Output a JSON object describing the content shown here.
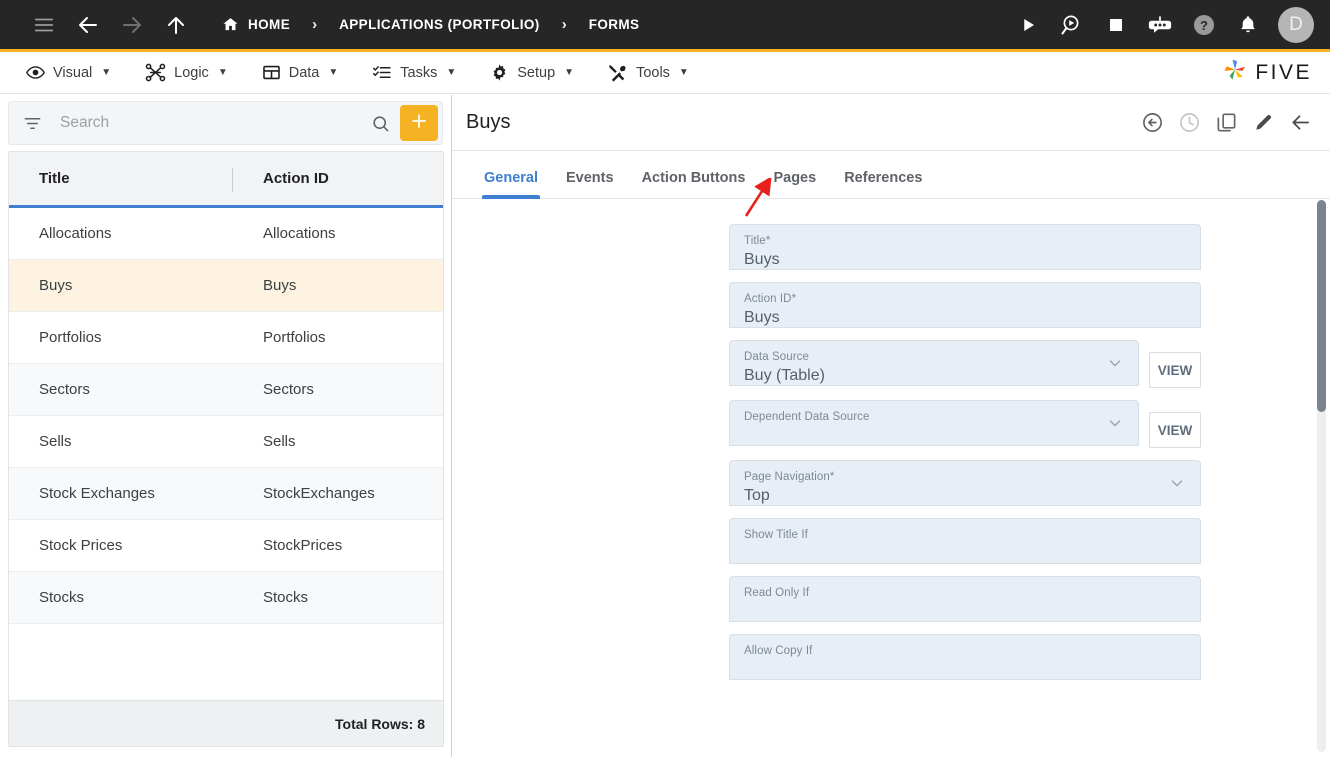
{
  "topbar": {
    "nav_icons": [
      {
        "name": "menu-icon",
        "label": "Menu"
      },
      {
        "name": "back-arrow-icon",
        "label": "Back"
      },
      {
        "name": "forward-arrow-icon",
        "label": "Forward"
      },
      {
        "name": "up-arrow-icon",
        "label": "Up"
      }
    ],
    "breadcrumbs": [
      {
        "label": "HOME",
        "icon": "home-icon"
      },
      {
        "label": "APPLICATIONS (PORTFOLIO)",
        "icon": ""
      },
      {
        "label": "FORMS",
        "icon": ""
      }
    ],
    "separator": "›",
    "right_icons": [
      {
        "name": "play-icon",
        "label": "Run"
      },
      {
        "name": "debug-magnifier-icon",
        "label": "Debug"
      },
      {
        "name": "stop-icon",
        "label": "Stop"
      },
      {
        "name": "bot-icon",
        "label": "Assistant"
      },
      {
        "name": "help-icon",
        "label": "Help"
      },
      {
        "name": "bell-icon",
        "label": "Notifications"
      }
    ],
    "avatar_initial": "D",
    "accent_color": "#f5b324",
    "background_color": "#262626"
  },
  "menubar": {
    "items": [
      {
        "label": "Visual",
        "icon": "eye-icon",
        "caret": "▼"
      },
      {
        "label": "Logic",
        "icon": "logic-nodes-icon",
        "caret": "▼"
      },
      {
        "label": "Data",
        "icon": "table-icon",
        "caret": "▼"
      },
      {
        "label": "Tasks",
        "icon": "checklist-icon",
        "caret": "▼"
      },
      {
        "label": "Setup",
        "icon": "gear-icon",
        "caret": "▼"
      },
      {
        "label": "Tools",
        "icon": "tools-icon",
        "caret": "▼"
      }
    ],
    "logo_text": "FIVE",
    "logo_icon": "five-pinwheel-logo"
  },
  "sidebar": {
    "search": {
      "placeholder": "Search",
      "value": "",
      "filter_icon": "filter-icon",
      "search_icon": "search-icon",
      "add_icon": "plus-icon",
      "add_button_color": "#f5b324"
    },
    "grid": {
      "columns": [
        "Title",
        "Action ID"
      ],
      "rows": [
        {
          "title": "Allocations",
          "action_id": "Allocations",
          "selected": false
        },
        {
          "title": "Buys",
          "action_id": "Buys",
          "selected": true
        },
        {
          "title": "Portfolios",
          "action_id": "Portfolios",
          "selected": false
        },
        {
          "title": "Sectors",
          "action_id": "Sectors",
          "selected": false
        },
        {
          "title": "Sells",
          "action_id": "Sells",
          "selected": false
        },
        {
          "title": "Stock Exchanges",
          "action_id": "StockExchanges",
          "selected": false
        },
        {
          "title": "Stock Prices",
          "action_id": "StockPrices",
          "selected": false
        },
        {
          "title": "Stocks",
          "action_id": "Stocks",
          "selected": false
        }
      ],
      "footer": "Total Rows: 8",
      "header_underline_color": "#3f7fd1",
      "selected_row_color": "#fdf3e0"
    }
  },
  "detail": {
    "title": "Buys",
    "header_icons": [
      {
        "name": "undo-icon",
        "label": "Undo",
        "faded": false
      },
      {
        "name": "history-clock-icon",
        "label": "History",
        "faded": true
      },
      {
        "name": "copy-icon",
        "label": "Duplicate",
        "faded": false
      },
      {
        "name": "edit-pencil-icon",
        "label": "Edit",
        "faded": false
      },
      {
        "name": "back-arrow-icon",
        "label": "Back",
        "faded": false
      }
    ],
    "tabs": [
      {
        "label": "General",
        "active": true
      },
      {
        "label": "Events",
        "active": false
      },
      {
        "label": "Action Buttons",
        "active": false
      },
      {
        "label": "Pages",
        "active": false
      },
      {
        "label": "References",
        "active": false
      }
    ],
    "active_tab_color": "#3f7fd1",
    "fields": [
      {
        "label": "Title",
        "required": true,
        "value": "Buys",
        "type": "text",
        "view_button": ""
      },
      {
        "label": "Action ID",
        "required": true,
        "value": "Buys",
        "type": "text",
        "view_button": ""
      },
      {
        "label": "Data Source",
        "required": false,
        "value": "Buy (Table)",
        "type": "select",
        "view_button": "VIEW"
      },
      {
        "label": "Dependent Data Source",
        "required": false,
        "value": "",
        "type": "select",
        "view_button": "VIEW"
      },
      {
        "label": "Page Navigation",
        "required": true,
        "value": "Top",
        "type": "select",
        "view_button": ""
      },
      {
        "label": "Show Title If",
        "required": false,
        "value": "",
        "type": "text",
        "view_button": ""
      },
      {
        "label": "Read Only If",
        "required": false,
        "value": "",
        "type": "text",
        "view_button": ""
      },
      {
        "label": "Allow Copy If",
        "required": false,
        "value": "",
        "type": "text",
        "view_button": ""
      }
    ],
    "required_marker": "*",
    "annotation": {
      "name": "red-arrow-annotation",
      "points_to": "Pages",
      "color": "#e8201c"
    }
  }
}
